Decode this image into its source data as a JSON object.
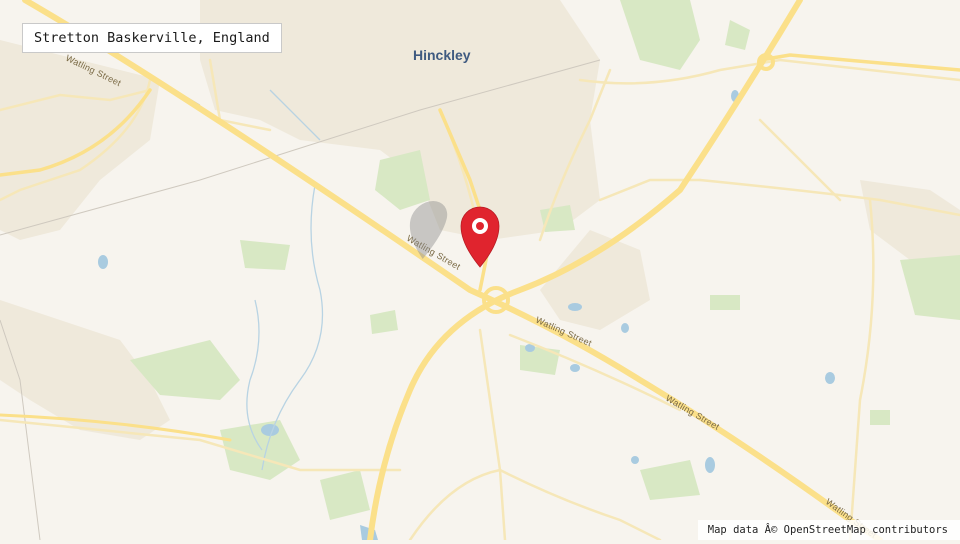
{
  "location": {
    "label": "Stretton Baskerville, England"
  },
  "map": {
    "town_label": "Hinckley",
    "road_labels": [
      "Watling Street",
      "Watling Street",
      "Watling Street",
      "Watling Street",
      "Watling Street"
    ],
    "marker_icon": "map-pin-icon",
    "colors": {
      "background": "#f7f4ee",
      "urban": "#efe9db",
      "green": "#d8e8c4",
      "water": "#a9cbe0",
      "major_road": "#fbe08a",
      "minor_road": "#f6e7b8",
      "marker": "#e0242e"
    }
  },
  "attribution": {
    "text": "Map data Â© OpenStreetMap contributors"
  }
}
